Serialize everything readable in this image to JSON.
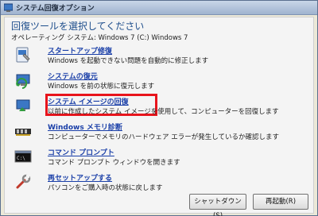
{
  "window": {
    "title": "システム回復オプション"
  },
  "heading": "回復ツールを選択してください",
  "os_line": "オペレーティング システム: Windows 7 (C:) Windows 7",
  "items": [
    {
      "label": "スタートアップ修復",
      "desc": "Windows を起動できない問題を自動的に修正します",
      "icon": "startup-repair-icon"
    },
    {
      "label": "システムの復元",
      "desc": "Windows を前の状態に復元します",
      "icon": "system-restore-icon"
    },
    {
      "label": "システム イメージの回復",
      "desc": "以前に作成したシステム イメージを使用して、コンピューターを回復します",
      "icon": "system-image-recovery-icon"
    },
    {
      "label": "Windows メモリ診断",
      "desc": "コンピューターでメモリのハードウェア エラーが発生しているか確認します",
      "icon": "memory-diagnostic-icon"
    },
    {
      "label": "コマンド プロンプト",
      "desc": "コマンド プロンプト ウィンドウを開きます",
      "icon": "command-prompt-icon"
    },
    {
      "label": "再セットアップする",
      "desc": "パソコンをご購入時の状態に戻します",
      "icon": "reinstall-icon"
    }
  ],
  "buttons": {
    "shutdown": "シャットダウン(S)",
    "restart": "再起動(R)"
  },
  "colors": {
    "link": "#1a3fa8",
    "highlight": "#e8141c",
    "heading": "#1e4e8c"
  }
}
